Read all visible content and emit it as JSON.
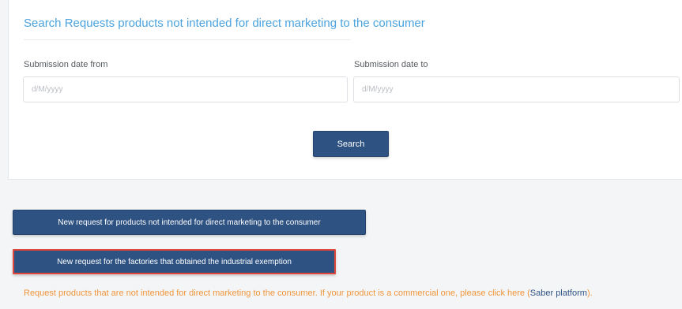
{
  "search_panel": {
    "title": "Search Requests products not intended for direct marketing to the consumer",
    "date_from": {
      "label": "Submission date from",
      "value": "",
      "placeholder": "d/M/yyyy"
    },
    "date_to": {
      "label": "Submission date to",
      "value": "",
      "placeholder": "d/M/yyyy"
    },
    "search_label": "Search"
  },
  "actions": {
    "new_request_label": "New request for products not intended for direct marketing to the consumer",
    "new_factory_request_label": "New request for the factories that obtained the industrial exemption"
  },
  "note": {
    "text": "Request products that are not intended for direct marketing to the consumer. If your product is a commercial one, please click here (",
    "link_label": "Saber platform",
    "suffix": ")."
  },
  "colors": {
    "title": "#4aa3df",
    "button": "#2e5282",
    "note": "#f0953a",
    "highlight_border": "#e0463c"
  }
}
